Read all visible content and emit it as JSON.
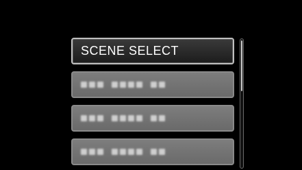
{
  "menu": {
    "items": [
      {
        "label": "SCENE SELECT",
        "selected": true
      },
      {
        "label": "",
        "selected": false
      },
      {
        "label": "",
        "selected": false
      },
      {
        "label": "",
        "selected": false
      }
    ]
  },
  "scrollbar": {
    "visible_fraction": 0.4,
    "position_fraction": 0.0
  },
  "colors": {
    "background": "#000000",
    "selected_item": "#2a2a2a",
    "unselected_item": "#737373",
    "text": "#ffffff"
  }
}
